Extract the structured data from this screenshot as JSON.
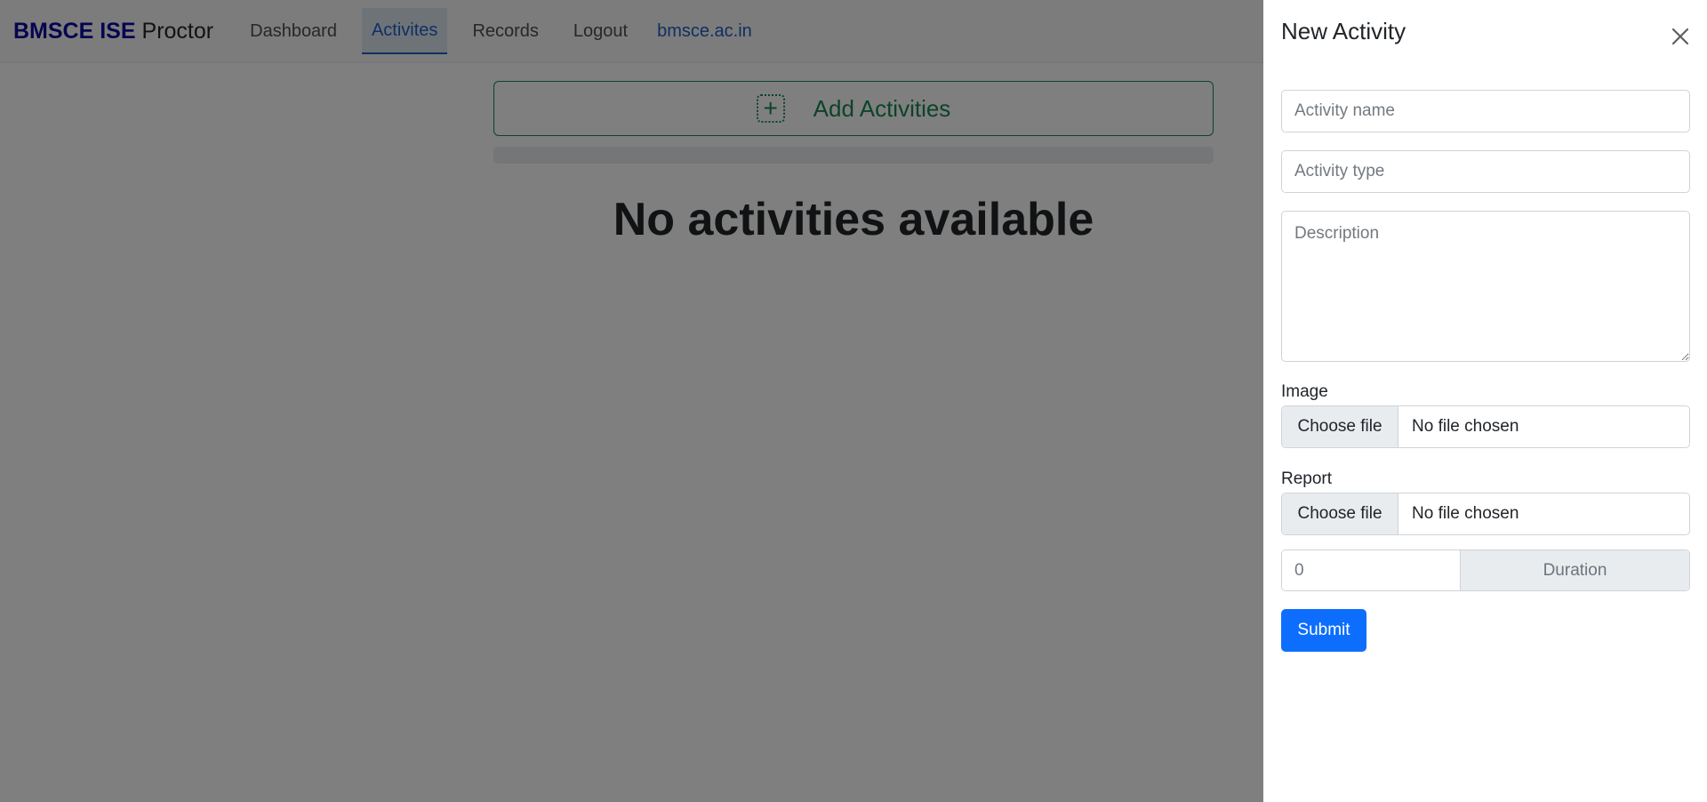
{
  "navbar": {
    "brand_strong": "BMSCE ISE",
    "brand_rest": "Proctor",
    "links": [
      {
        "label": "Dashboard"
      },
      {
        "label": "Activites"
      },
      {
        "label": "Records"
      },
      {
        "label": "Logout"
      },
      {
        "label": "bmsce.ac.in"
      }
    ],
    "active_link": "Activites"
  },
  "main": {
    "add_button_label": "Add Activities",
    "empty_message": "No activities available"
  },
  "offcanvas": {
    "title": "New Activity",
    "activity_name_placeholder": "Activity name",
    "activity_type_placeholder": "Activity type",
    "description_placeholder": "Description",
    "image_label": "Image",
    "image_button": "Choose file",
    "image_status": "No file chosen",
    "report_label": "Report",
    "report_button": "Choose file",
    "report_status": "No file chosen",
    "duration_placeholder": "0",
    "duration_addon": "Duration",
    "submit_label": "Submit"
  },
  "colors": {
    "brand": "#0a0a9e",
    "success": "#198754",
    "primary": "#0d6efd",
    "backdrop": "rgba(0,0,0,0.5)"
  }
}
